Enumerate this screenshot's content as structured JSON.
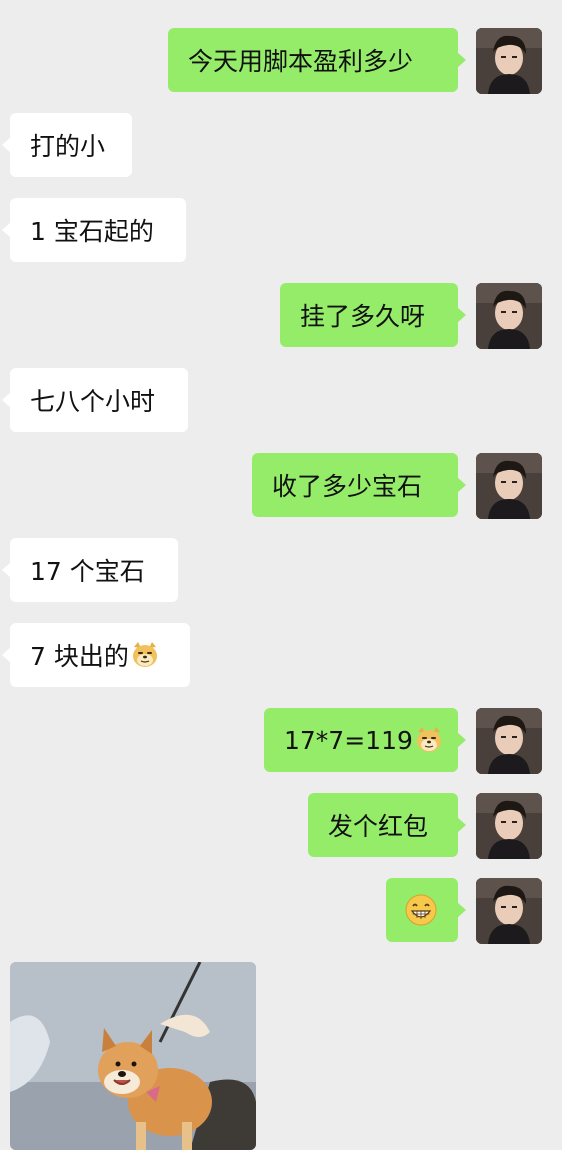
{
  "colors": {
    "background": "#ededed",
    "outgoing_bubble": "#95ec69",
    "incoming_bubble": "#ffffff"
  },
  "messages": [
    {
      "side": "out",
      "text": "今天用脚本盈利多少"
    },
    {
      "side": "in",
      "text": "打的小"
    },
    {
      "side": "in",
      "text": "1 宝石起的"
    },
    {
      "side": "out",
      "text": "挂了多久呀"
    },
    {
      "side": "in",
      "text": "七八个小时"
    },
    {
      "side": "out",
      "text": "收了多少宝石"
    },
    {
      "side": "in",
      "text": "17 个宝石"
    },
    {
      "side": "in",
      "text": "7 块出的",
      "emoji": "doge-emoji"
    },
    {
      "side": "out",
      "text": "17*7=119",
      "emoji": "doge-emoji"
    },
    {
      "side": "out",
      "text": "发个红包"
    },
    {
      "side": "out",
      "text": "",
      "emoji": "grin-emoji"
    }
  ],
  "image_message": {
    "side": "in",
    "icon": "shiba-dog-photo"
  }
}
